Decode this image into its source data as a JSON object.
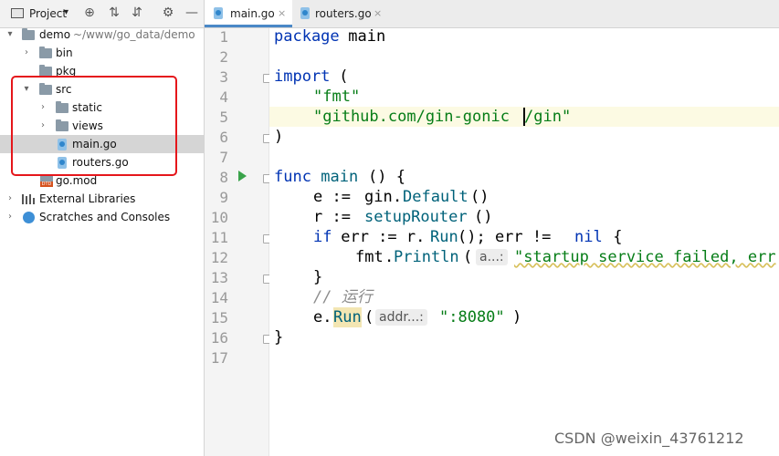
{
  "project": {
    "title": "Project",
    "caret": "▾",
    "icons": {
      "locate": "⊕",
      "expand": "⇅",
      "collapse": "⇵",
      "gear": "⚙",
      "minimize": "—"
    },
    "tree": {
      "root": {
        "name": "demo",
        "path": "~/www/go_data/demo"
      },
      "bin": "bin",
      "pkg": "pkg",
      "src": "src",
      "static": "static",
      "views": "views",
      "main_go": "main.go",
      "routers_go": "routers.go",
      "go_mod": "go.mod",
      "gomod_badge": "DTD",
      "external": "External Libraries",
      "scratches": "Scratches and Consoles"
    },
    "highlight_color": "#e5161b"
  },
  "tabs": [
    {
      "label": "main.go",
      "close": "×",
      "active": true
    },
    {
      "label": "routers.go",
      "close": "×",
      "active": false
    }
  ],
  "gutter": {
    "lines": [
      "1",
      "2",
      "3",
      "4",
      "5",
      "6",
      "7",
      "8",
      "9",
      "10",
      "11",
      "12",
      "13",
      "14",
      "15",
      "16",
      "17"
    ]
  },
  "code": {
    "l1": {
      "kw": "package",
      "rest": " main"
    },
    "l3": {
      "kw": "import",
      "rest": " ("
    },
    "l4": {
      "str": "\"fmt\""
    },
    "l5": {
      "str_a": "\"github.com/gin-gonic",
      "str_b": "/gin\""
    },
    "l6": {
      "text": ")"
    },
    "l8": {
      "kw": "func",
      "fn": " main",
      "rest": "() {"
    },
    "l9": {
      "a": "e := ",
      "b": "gin",
      "c": ".",
      "d": "Default",
      "e": "()"
    },
    "l10": {
      "a": "r := ",
      "b": "setupRouter",
      "c": "()"
    },
    "l11": {
      "kw": "if",
      "a": " err := r.",
      "fn": "Run",
      "b": "(); err != ",
      "nil": "nil",
      "c": " {"
    },
    "l12": {
      "a": "fmt",
      "b": ".",
      "fn": "Println",
      "c": "(",
      "hint": "a...:",
      "str": "\"startup service failed, err"
    },
    "l13": {
      "text": "}"
    },
    "l14": {
      "text": "// 运行"
    },
    "l15": {
      "a": "e.",
      "fn": "Run",
      "b": "(",
      "hint": "addr...:",
      "str": "\":8080\"",
      "c": ")"
    },
    "l16": {
      "text": "}"
    }
  },
  "watermark": "CSDN @weixin_43761212"
}
